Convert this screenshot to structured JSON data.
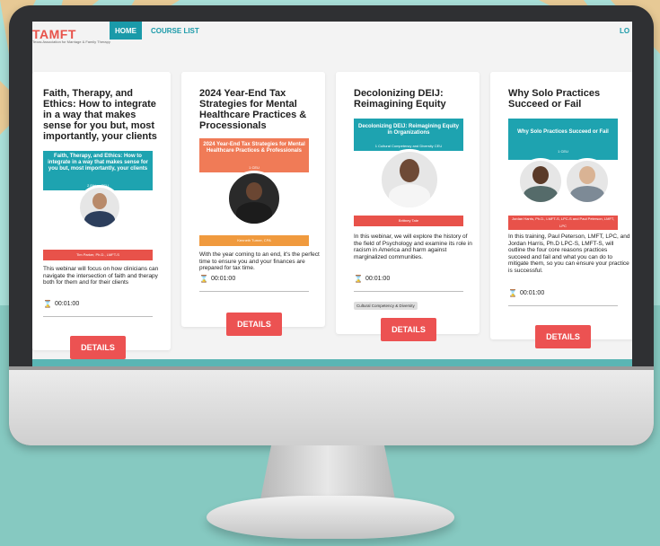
{
  "nav": {
    "logo": "TAMFT",
    "logo_sub": "Texas Association for Marriage & Family Therapy",
    "home": "HOME",
    "course_list": "COURSE LIST",
    "login": "LO"
  },
  "cards": [
    {
      "title": "Faith, Therapy, and Ethics: How to integrate in a way that makes sense for you but, most importantly, your clients",
      "thumb_title": "Faith, Therapy, and Ethics: How to integrate in a way that makes sense for you but, most importantly, your clients",
      "thumb_sub": "2 Ethics CEU",
      "thumb_presenter": "Tim Parker, Ph.D., LMFT-S",
      "description": "This webinar will focus on how clinicians can navigate the intersection of faith and therapy both for them and for their clients",
      "duration": "00:01:00",
      "details_label": "DETAILS"
    },
    {
      "title": "2024 Year-End Tax Strategies for Mental Healthcare Practices & Processionals",
      "thumb_title": "2024 Year-End Tax Strategies for Mental Healthcare Practices & Professionals",
      "thumb_sub": "1 CEU",
      "thumb_presenter": "Kenneth Turner, CPA",
      "description": "With the year coming to an end, it's the perfect time to ensure you and your finances are prepared for tax time.",
      "duration": "00:01:00",
      "details_label": "DETAILS"
    },
    {
      "title": "Decolonizing DEIJ: Reimagining Equity",
      "thumb_title": "Decolonizing DEIJ: Reimagining Equity in Organizations",
      "thumb_sub": "1 Cultural Competency and Diversity CEU",
      "thumb_presenter": "Brittney Tate",
      "description": "In this webinar, we will explore the history of the field of Psychology and examine its role in racism in America and harm against marginalized communities.",
      "duration": "00:01:00",
      "tag": "Cultural Competency & Diversity",
      "details_label": "DETAILS"
    },
    {
      "title": "Why Solo Practices Succeed or Fail",
      "thumb_title": "Why Solo Practices Succeed or Fail",
      "thumb_sub": "1 CEU",
      "thumb_presenter": "Jordan Harris, Ph.D., LMFT-S, LPC-S and Paul Peterson, LMFT, LPC",
      "description": "In this training, Paul Peterson, LMFT, LPC, and Jordan Harris, Ph.D LPC-S, LMFT-S, will outline the four core reasons practices succeed and fail and what you can do to mitigate them, so you can ensure your practice is successful.",
      "duration": "00:01:00",
      "details_label": "DETAILS"
    }
  ],
  "colors": {
    "teal": "#1a9aa9",
    "coral": "#ec5252",
    "background": "#a9e0d9"
  },
  "icons": {
    "duration": "hourglass-icon"
  }
}
